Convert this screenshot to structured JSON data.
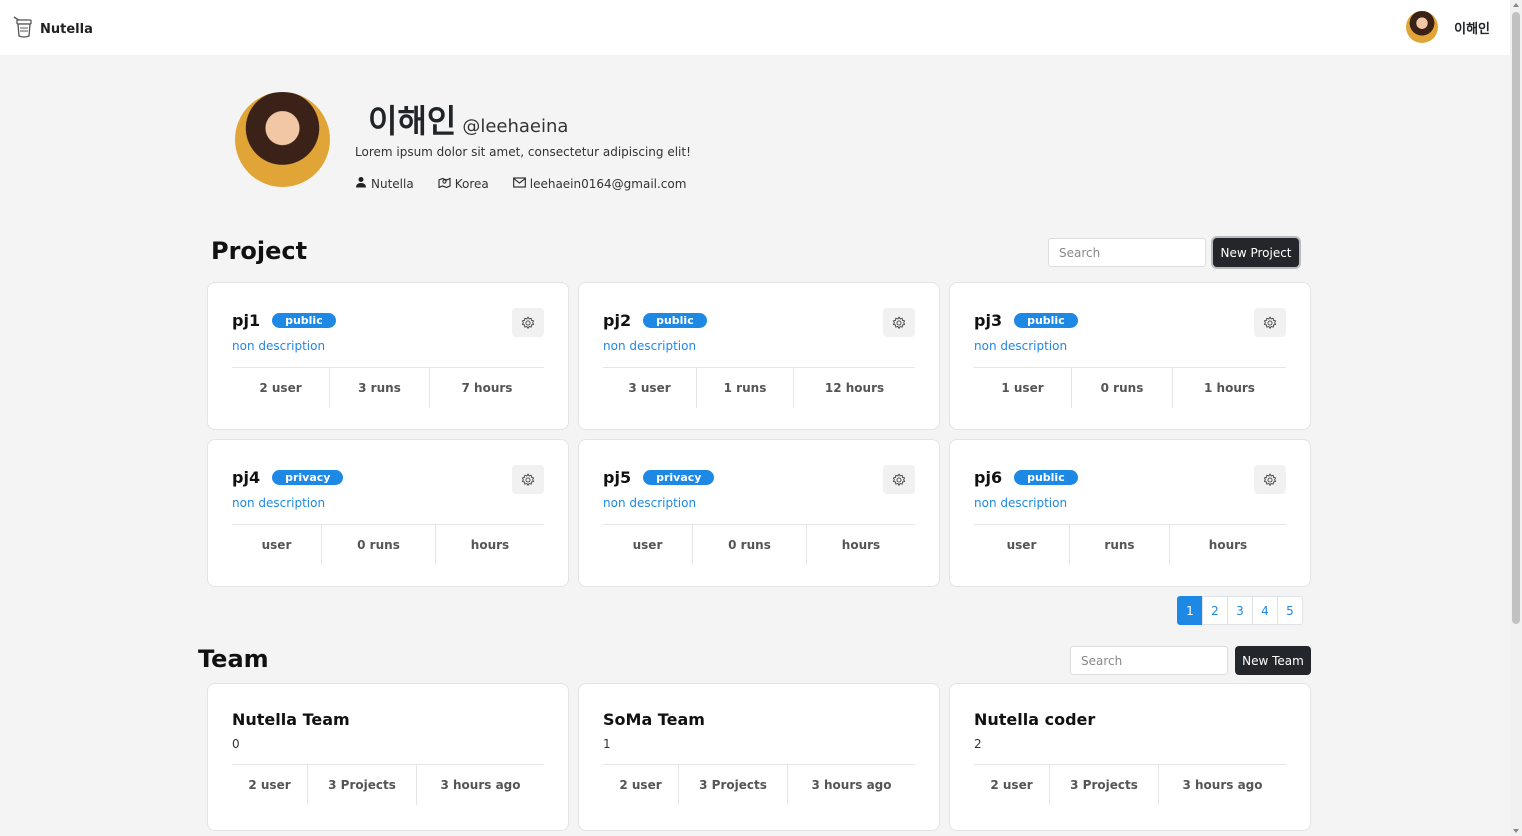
{
  "app": {
    "name": "Nutella"
  },
  "user": {
    "display_name": "이해인",
    "handle": "@leehaeina",
    "bio": "Lorem ipsum dolor sit amet, consectetur adipiscing elit!",
    "organization": "Nutella",
    "location": "Korea",
    "email": "leehaein0164@gmail.com"
  },
  "projects": {
    "title": "Project",
    "search_placeholder": "Search",
    "new_label": "New Project",
    "items": [
      {
        "name": "pj1",
        "visibility": "public",
        "description": "non description",
        "users": "2 user",
        "runs": "3 runs",
        "hours": "7 hours"
      },
      {
        "name": "pj2",
        "visibility": "public",
        "description": "non description",
        "users": "3 user",
        "runs": "1 runs",
        "hours": "12 hours"
      },
      {
        "name": "pj3",
        "visibility": "public",
        "description": "non description",
        "users": "1 user",
        "runs": "0 runs",
        "hours": "1 hours"
      },
      {
        "name": "pj4",
        "visibility": "privacy",
        "description": "non description",
        "users": "user",
        "runs": "0 runs",
        "hours": "hours"
      },
      {
        "name": "pj5",
        "visibility": "privacy",
        "description": "non description",
        "users": "user",
        "runs": "0 runs",
        "hours": "hours"
      },
      {
        "name": "pj6",
        "visibility": "public",
        "description": "non description",
        "users": "user",
        "runs": "runs",
        "hours": "hours"
      }
    ],
    "pages": [
      "1",
      "2",
      "3",
      "4",
      "5"
    ],
    "current_page": "1"
  },
  "teams": {
    "title": "Team",
    "search_placeholder": "Search",
    "new_label": "New Team",
    "items": [
      {
        "name": "Nutella Team",
        "count": "0",
        "users": "2 user",
        "projects": "3 Projects",
        "updated": "3 hours ago"
      },
      {
        "name": "SoMa Team",
        "count": "1",
        "users": "2 user",
        "projects": "3 Projects",
        "updated": "3 hours ago"
      },
      {
        "name": "Nutella coder",
        "count": "2",
        "users": "2 user",
        "projects": "3 Projects",
        "updated": "3 hours ago"
      }
    ]
  },
  "colors": {
    "accent": "#1e88e5",
    "dark_button": "#23272b",
    "background": "#f4f4f4"
  },
  "icons": [
    "logo-jar-icon",
    "user-icon",
    "location-icon",
    "mail-icon",
    "gear-icon"
  ]
}
